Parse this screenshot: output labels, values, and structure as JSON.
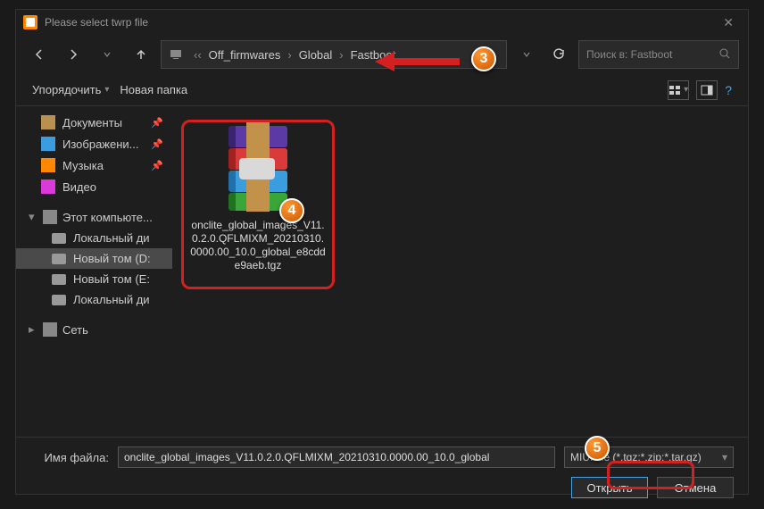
{
  "title": "Please select twrp file",
  "breadcrumb": {
    "p0": "Off_firmwares",
    "p1": "Global",
    "p2": "Fastboot"
  },
  "search": {
    "placeholder": "Поиск в: Fastboot"
  },
  "toolbar": {
    "organize": "Упорядочить",
    "newfolder": "Новая папка"
  },
  "sidebar": {
    "quick": {
      "documents": "Документы",
      "pictures": "Изображени...",
      "music": "Музыка",
      "video": "Видео"
    },
    "thispc": "Этот компьюте...",
    "drives": {
      "d0": "Локальный ди",
      "d1": "Новый том (D:",
      "d2": "Новый том (E:",
      "d3": "Локальный ди"
    },
    "network": "Сеть"
  },
  "file": {
    "name": "onclite_global_images_V11.0.2.0.QFLMIXM_20210310.0000.00_10.0_global_e8cdde9aeb.tgz"
  },
  "footer": {
    "label": "Имя файла:",
    "value": "onclite_global_images_V11.0.2.0.QFLMIXM_20210310.0000.00_10.0_global",
    "filter": "MIUI file (*.tgz;*.zip;*.tar.gz)",
    "open": "Открыть",
    "cancel": "Отмена"
  },
  "callouts": {
    "c3": "3",
    "c4": "4",
    "c5": "5"
  }
}
